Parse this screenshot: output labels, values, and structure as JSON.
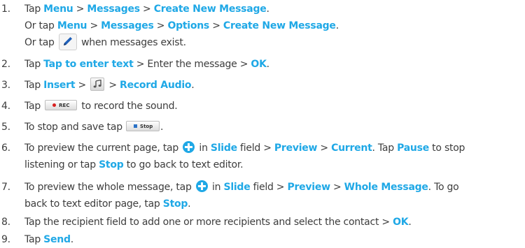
{
  "steps": [
    {
      "num": "1.",
      "lines": [
        [
          "Tap ",
          {
            "hl": "Menu"
          },
          " > ",
          {
            "hl": "Messages"
          },
          " > ",
          {
            "hl": "Create New Message"
          },
          "."
        ],
        [
          "Or tap ",
          {
            "hl": "Menu"
          },
          " > ",
          {
            "hl": "Messages"
          },
          " > ",
          {
            "hl": "Options"
          },
          " > ",
          {
            "hl": "Create New Message"
          },
          "."
        ],
        [
          "Or tap ",
          {
            "icon": "pencil-icon"
          },
          " when messages exist."
        ]
      ]
    },
    {
      "num": "2.",
      "lines": [
        [
          "Tap ",
          {
            "hl": "Tap to enter text"
          },
          " > Enter the message > ",
          {
            "hl": "OK"
          },
          "."
        ]
      ]
    },
    {
      "num": "3.",
      "lines": [
        [
          "Tap ",
          {
            "hl": "Insert"
          },
          " > ",
          {
            "icon": "music-note-icon"
          },
          " > ",
          {
            "hl": "Record Audio"
          },
          "."
        ]
      ]
    },
    {
      "num": "4.",
      "lines": [
        [
          "Tap ",
          {
            "btn": "rec-button",
            "label": "REC"
          },
          " to record the sound."
        ]
      ]
    },
    {
      "num": "5.",
      "lines": [
        [
          "To stop and save tap ",
          {
            "btn": "stop-button",
            "label": "Stop"
          },
          "."
        ]
      ]
    },
    {
      "num": "6.",
      "lines": [
        [
          "To preview the current page, tap ",
          {
            "icon": "plus-circle-icon"
          },
          " in ",
          {
            "hl": "Slide"
          },
          " field > ",
          {
            "hl": "Preview"
          },
          " > ",
          {
            "hl": "Current"
          },
          ". Tap ",
          {
            "hl": "Pause"
          },
          " to stop"
        ],
        [
          "listening or tap ",
          {
            "hl": "Stop"
          },
          " to go back to text editor."
        ]
      ]
    },
    {
      "num": "7.",
      "lines": [
        [
          "To preview the whole message, tap ",
          {
            "icon": "plus-circle-icon"
          },
          " in ",
          {
            "hl": "Slide"
          },
          " field > ",
          {
            "hl": "Preview"
          },
          " > ",
          {
            "hl": "Whole Message"
          },
          ". To go"
        ],
        [
          "back to text editor page, tap ",
          {
            "hl": "Stop"
          },
          "."
        ]
      ]
    },
    {
      "num": "8.",
      "lines": [
        [
          "Tap the recipient field to add one or more recipients and select the contact > ",
          {
            "hl": "OK"
          },
          "."
        ]
      ]
    },
    {
      "num": "9.",
      "lines": [
        [
          "Tap ",
          {
            "hl": "Send"
          },
          "."
        ]
      ]
    }
  ]
}
